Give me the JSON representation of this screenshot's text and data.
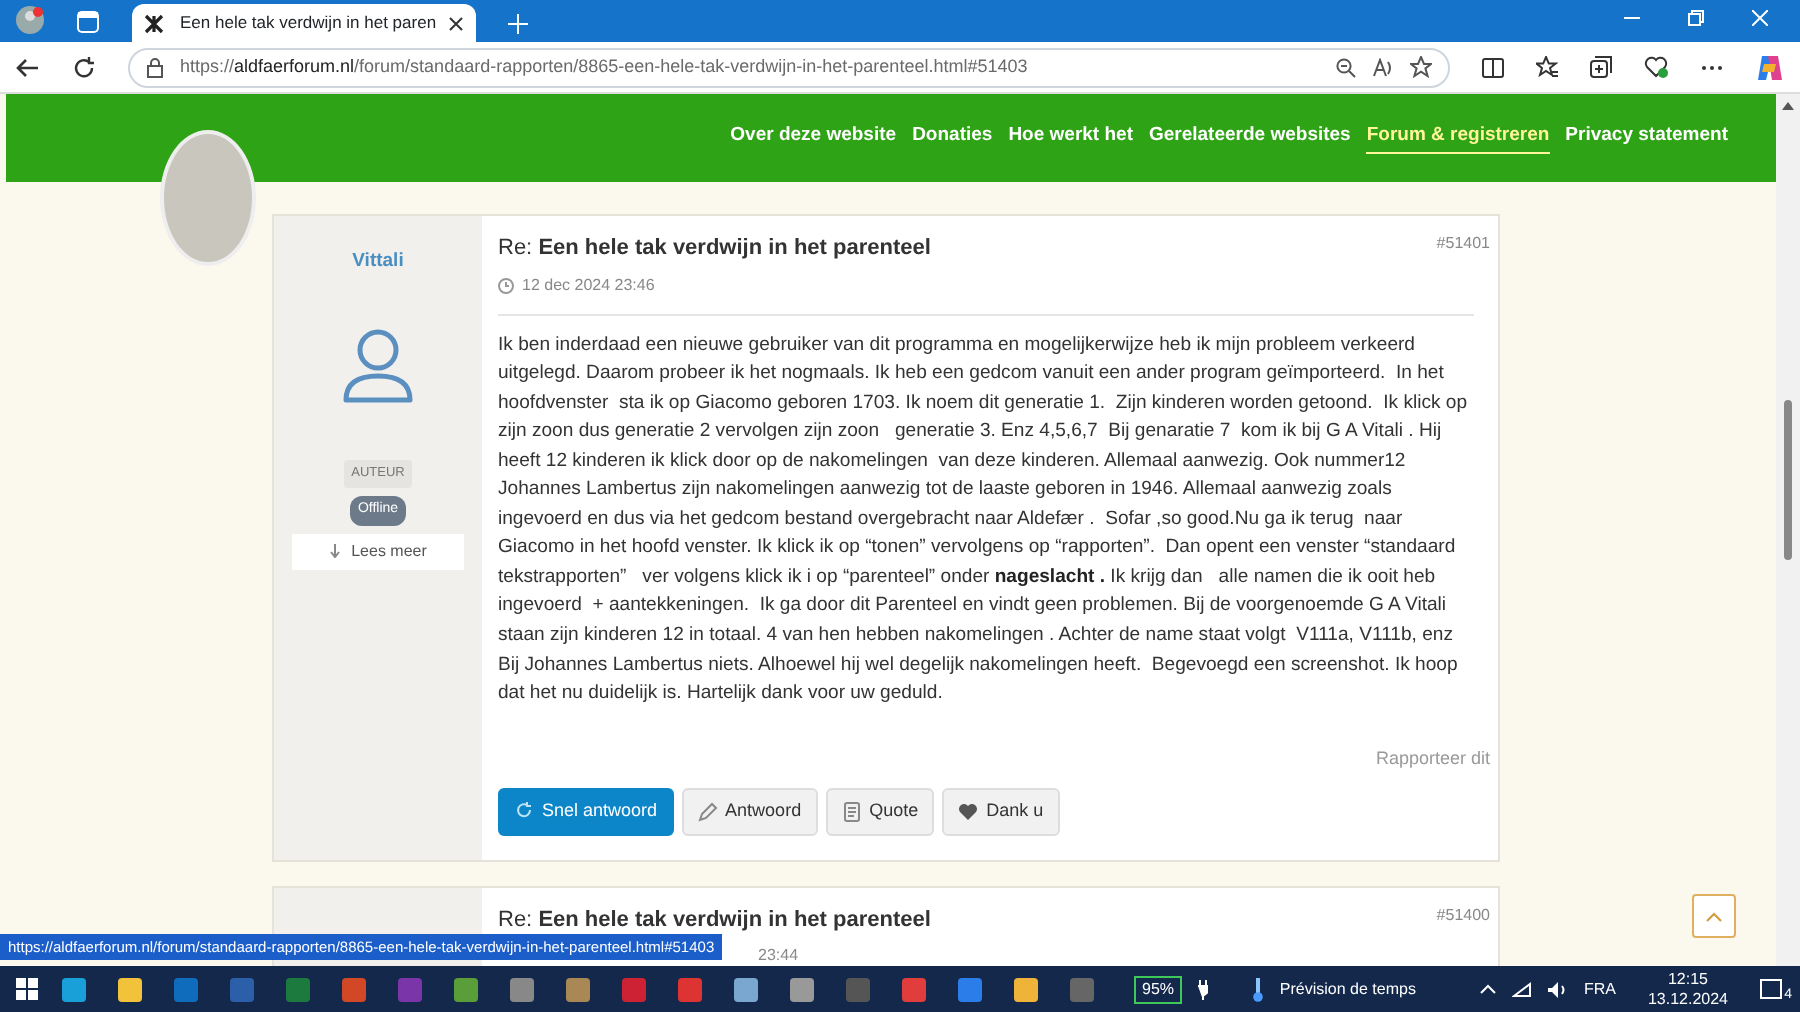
{
  "browser": {
    "tab_title": "Een hele tak verdwijn in het paren",
    "url": "https://**aldfaerforum.nl**/forum/standaard-rapporten/8865-een-hele-tak-verdwijn-in-het-parenteel.html#51403"
  },
  "nav": [
    {
      "label": "Over deze website",
      "selected": false
    },
    {
      "label": "Donaties",
      "selected": false
    },
    {
      "label": "Hoe werkt het",
      "selected": false
    },
    {
      "label": "Gerelateerde websites",
      "selected": false
    },
    {
      "label": "Forum & registreren",
      "selected": true
    },
    {
      "label": "Privacy statement",
      "selected": false
    }
  ],
  "posts": [
    {
      "author": "Vittali",
      "title": "Re: **Een hele tak verdwijn in het parenteel**",
      "date": "12 dec 2024 23:46",
      "number": "#51401",
      "role": "AUTEUR",
      "status": "Offline",
      "more": "Lees meer",
      "body": "Ik ben inderdaad een nieuwe gebruiker van dit programma en mogelijkerwijze heb ik mijn probleem verkeerd uitgelegd. Daarom probeer ik het nogmaals. Ik heb een gedcom vanuit een ander program geïmporteerd.  In het hoofdvenster  sta ik op Giacomo geboren 1703. Ik noem dit generatie 1.  Zijn kinderen worden getoond.  Ik klick op zijn zoon dus generatie 2 vervolgen zijn zoon   generatie 3. Enz 4,5,6,7  Bij genaratie 7  kom ik bij G A Vitali . Hij heeft 12 kinderen ik klick door op de nakomelingen  van deze kinderen. Allemaal aanwezig. Ook nummer12 Johannes Lambertus zijn nakomelingen aanwezig tot de laaste geboren in 1946. Allemaal aanwezig zoals ingevoerd en dus via het gedcom bestand overgebracht naar Aldefær .  Sofar ,so good.Nu ga ik terug  naar Giacomo in het hoofd venster. Ik klick ik op “tonen” vervolgens op “rapporten”.  Dan opent een venster “standaard tekstrapporten”   ver volgens klick ik i op “parenteel” onder **nageslacht .** Ik krijg dan   alle namen die ik ooit heb ingevoerd  + aantekkeningen.  Ik ga door dit Parenteel en vindt geen problemen. Bij de voorgenoemde G A Vitali staan zijn kinderen 12 in totaal. 4 van hen hebben nakomelingen . Achter de name staat volgt  V111a, V111b, enz  Bij Johannes Lambertus niets. Alhoewel hij wel degelijk nakomelingen heeft.  Begevoegd een screenshot. Ik hoop dat het nu duidelijk is. Hartelijk dank voor uw geduld.",
      "report": "Rapporteer dit",
      "buttons": [
        {
          "label": "Snel antwoord",
          "kind": "quick"
        },
        {
          "label": "Antwoord",
          "kind": "reply"
        },
        {
          "label": "Quote",
          "kind": "quote"
        },
        {
          "label": "Dank u",
          "kind": "thanks"
        }
      ]
    },
    {
      "title": "Re: **Een hele tak verdwijn in het parenteel**",
      "date": "23:44",
      "number": "#51400"
    }
  ],
  "status_url": "https://aldfaerforum.nl/forum/standaard-rapporten/8865-een-hele-tak-verdwijn-in-het-parenteel.html#51403",
  "taskbar": {
    "battery": "95%",
    "weather": "Prévision de temps",
    "language": "FRA",
    "time": "12:15",
    "date": "13.12.2024",
    "notifications": "4"
  }
}
